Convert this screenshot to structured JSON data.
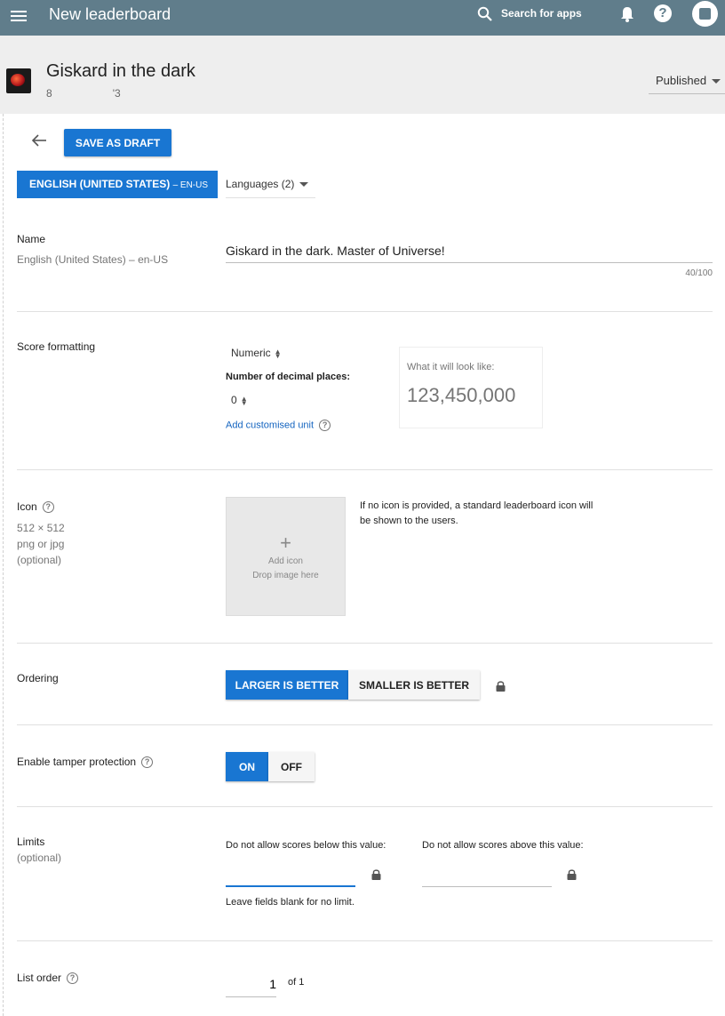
{
  "topbar": {
    "title": "New leaderboard",
    "search_label": "Search for apps",
    "help_label": "?"
  },
  "app": {
    "name": "Giskard in the dark",
    "id_start": "8",
    "id_end": "'3",
    "status": "Published"
  },
  "toolbar": {
    "save_draft_label": "SAVE AS DRAFT"
  },
  "language": {
    "active_tab": "ENGLISH (UNITED STATES)",
    "active_tab_code": "– EN-US",
    "languages_dropdown": "Languages (2)"
  },
  "name_section": {
    "label": "Name",
    "sub": "English (United States) – en-US",
    "value": "Giskard in the dark. Master of Universe!",
    "char_count": "40/100"
  },
  "score_formatting": {
    "label": "Score formatting",
    "format": "Numeric",
    "decimal_label": "Number of decimal places:",
    "decimal_value": "0",
    "add_unit_link": "Add customised unit",
    "preview_label": "What it will look like:",
    "preview_value": "123,450,000"
  },
  "icon_section": {
    "label": "Icon",
    "size": "512 × 512",
    "formats": "png or jpg",
    "optional": "(optional)",
    "plus": "+",
    "add_icon": "Add icon",
    "drop_here": "Drop image here",
    "note": "If no icon is provided, a standard leaderboard icon will be shown to the users."
  },
  "ordering": {
    "label": "Ordering",
    "larger": "LARGER IS BETTER",
    "smaller": "SMALLER IS BETTER",
    "selected": "LARGER IS BETTER"
  },
  "tamper": {
    "label": "Enable tamper protection",
    "on": "ON",
    "off": "OFF",
    "selected": "ON"
  },
  "limits": {
    "label": "Limits",
    "optional": "(optional)",
    "below_label": "Do not allow scores below this value:",
    "above_label": "Do not allow scores above this value:",
    "below_value": "",
    "above_value": "",
    "note": "Leave fields blank for no limit."
  },
  "list_order": {
    "label": "List order",
    "value": "1",
    "of": "of 1"
  },
  "colors": {
    "topbar": "#607d8b",
    "primary": "#1976d2",
    "link": "#1565c0"
  }
}
